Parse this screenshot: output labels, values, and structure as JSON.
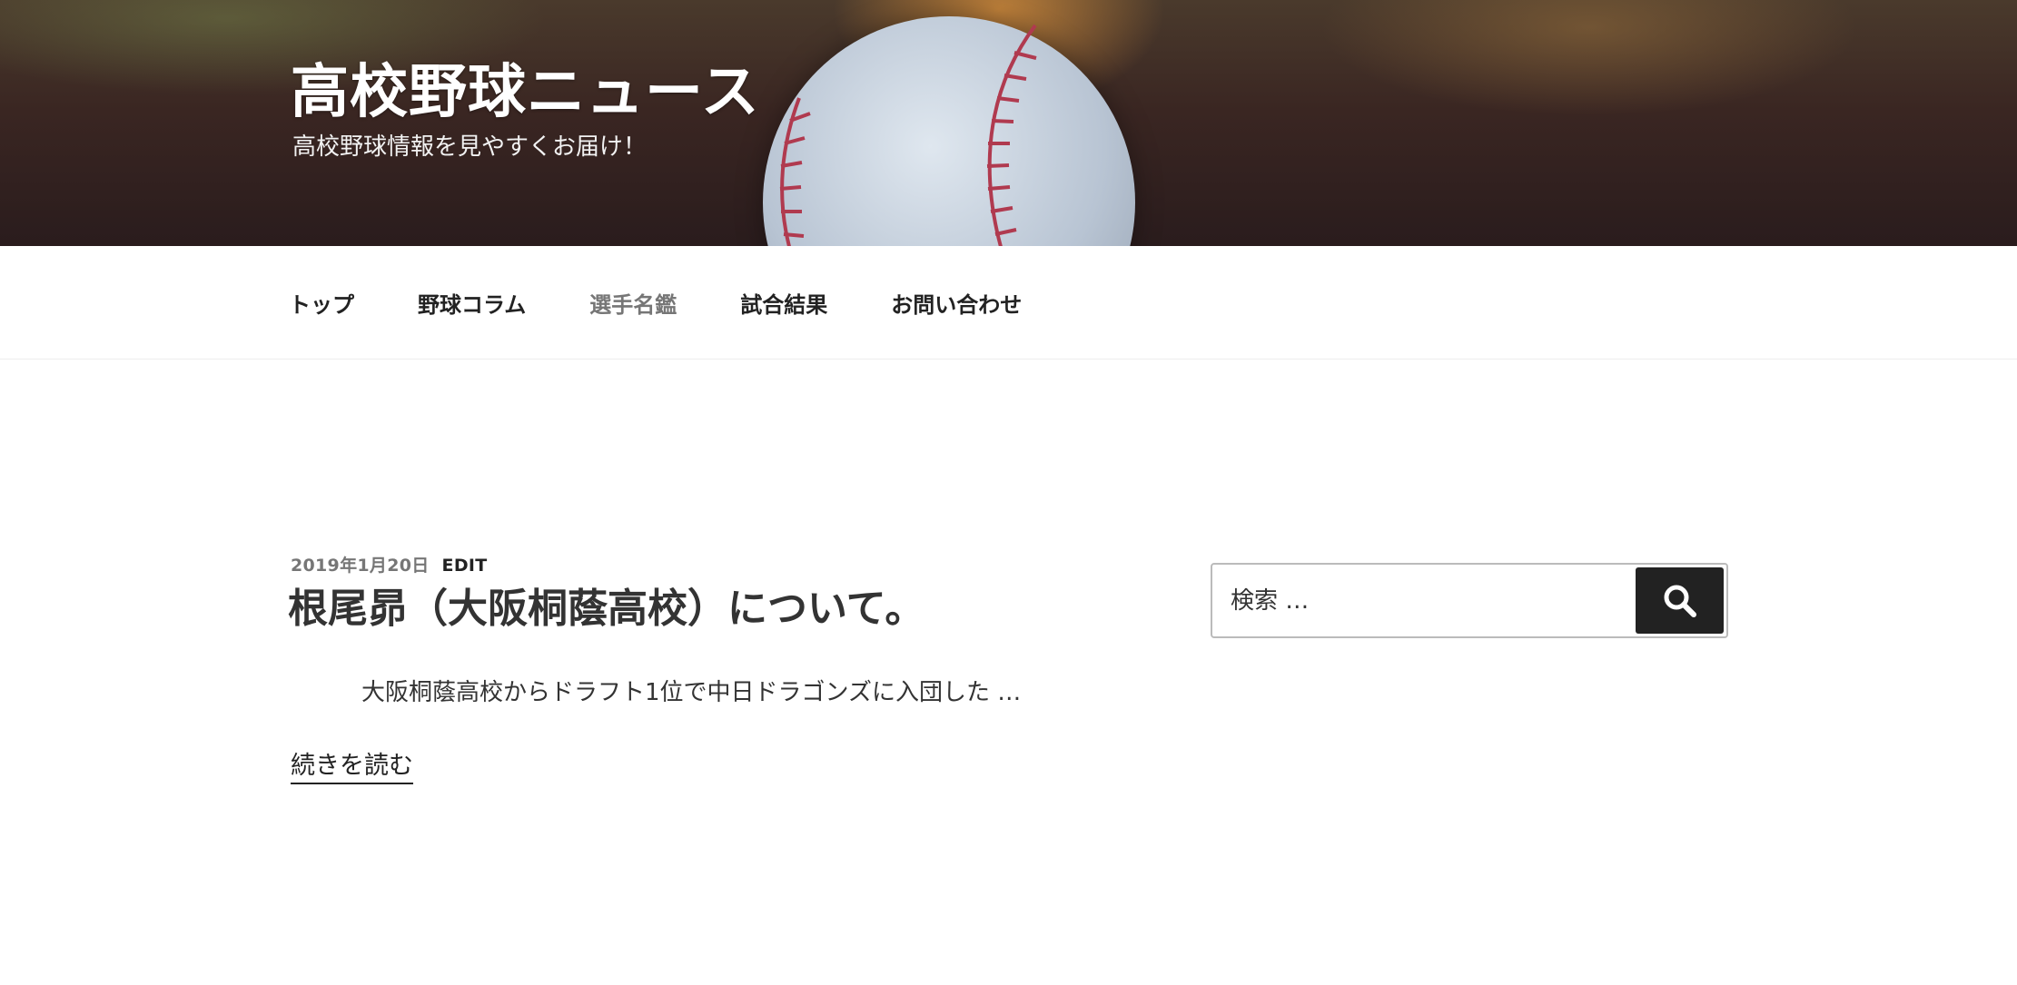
{
  "site": {
    "title": "高校野球ニュース",
    "description": "高校野球情報を見やすくお届け！"
  },
  "navigation": {
    "items": [
      {
        "label": "トップ",
        "current": false
      },
      {
        "label": "野球コラム",
        "current": false
      },
      {
        "label": "選手名鑑",
        "current": true
      },
      {
        "label": "試合結果",
        "current": false
      },
      {
        "label": "お問い合わせ",
        "current": false
      }
    ]
  },
  "post": {
    "date": "2019年1月20日",
    "edit_label": "EDIT",
    "title": "根尾昴（大阪桐蔭高校）について。",
    "excerpt": "大阪桐蔭高校からドラフト1位で中日ドラゴンズに入団した …",
    "read_more": "続きを読む"
  },
  "search": {
    "placeholder": "検索 …",
    "button_icon": "search-icon"
  },
  "colors": {
    "text": "#222222",
    "muted": "#767676",
    "button_bg": "#222222",
    "header_dark": "#2a1c1d"
  }
}
